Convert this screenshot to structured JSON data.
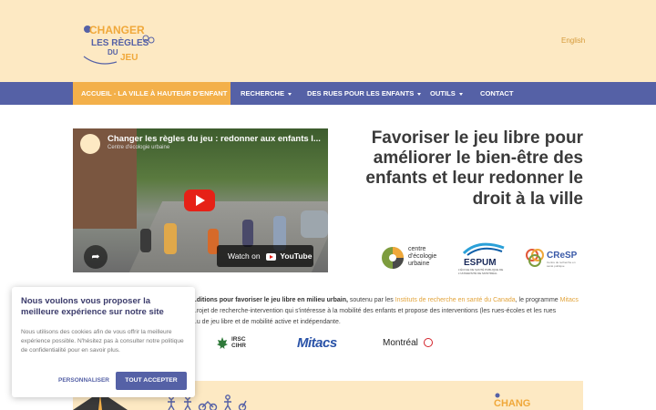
{
  "header": {
    "logo_alt": "Changer les règles du jeu",
    "language_link": "English"
  },
  "nav": {
    "items": [
      {
        "label": "Accueil - La ville à hauteur d'enfant",
        "active": true,
        "dropdown": false
      },
      {
        "label": "Recherche",
        "active": false,
        "dropdown": true
      },
      {
        "label": "Des rues pour les enfants",
        "active": false,
        "dropdown": true
      },
      {
        "label": "Outils",
        "active": false,
        "dropdown": true
      },
      {
        "label": "Contact",
        "active": false,
        "dropdown": false
      }
    ]
  },
  "video": {
    "title": "Changer les règles du jeu : redonner aux enfants l...",
    "channel": "Centre d'écologie urbaine",
    "watch_on": "Watch on",
    "platform": "YouTube"
  },
  "hero": {
    "title": "Favoriser le jeu libre pour améliorer le bien-être des enfants et leur redonner le droit à la ville"
  },
  "partners": {
    "ceu": {
      "line1": "centre",
      "line2": "d'écologie",
      "line3": "urbaine"
    },
    "espum": {
      "name": "ESPUM",
      "sub": "L'ÉCOLE DE SANTÉ PUBLIQUE DE L'UNIVERSITÉ DE MONTRÉAL"
    },
    "cresp": {
      "name": "CReSP",
      "sub": "Centre de recherche en santé publique"
    }
  },
  "intro": {
    "bold_part": "...ditions pour favoriser le jeu libre en milieu urbain,",
    "text1": " soutenu par les ",
    "link1": "Instituts de recherche en santé du Canada",
    "text2": ", le programme ",
    "link2": "Mitacs",
    "line2": "...rojet de recherche-intervention qui s'intéresse à la mobilité des enfants et propose des interventions (les rues-écoles et les rues",
    "line3": "...u de jeu libre et de mobilité active et indépendante."
  },
  "funders": {
    "irsc": {
      "line1": "IRSC",
      "line2": "CIHR"
    },
    "mitacs": "Mitacs",
    "montreal": "Montréal"
  },
  "cookie": {
    "title": "Nous voulons vous proposer la meilleure expérience sur notre site",
    "text": "Nous utilisons des cookies afin de vous offrir la meilleure expérience possible. N'hésitez pas à consulter notre politique de confidentialité pour en savoir plus.",
    "customize_label": "PERSONNALISER",
    "accept_label": "TOUT ACCEPTER"
  },
  "colors": {
    "header_bg": "#fde9c3",
    "nav_bg": "#5561a6",
    "nav_active": "#f3b04a",
    "link_accent": "#e2a43c",
    "youtube_red": "#e62117"
  }
}
